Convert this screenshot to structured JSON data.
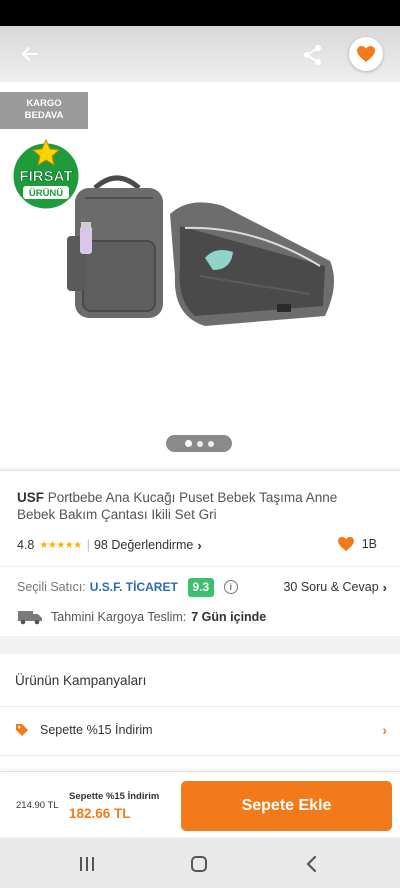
{
  "header": {
    "back_icon": "arrow-left-icon",
    "share_icon": "share-icon",
    "favorite_icon": "heart-icon"
  },
  "badges": {
    "cargo_line1": "KARGO",
    "cargo_line2": "BEDAVA",
    "firsat_line1": "FIRSAT",
    "firsat_line2": "ÜRÜNÜ"
  },
  "gallery": {
    "image_count": 3,
    "active_index": 0
  },
  "product": {
    "brand": "USF",
    "name": "Portbebe Ana Kucağı Puset Bebek Taşıma Anne Bebek Bakım Çantası Ikili Set Gri",
    "rating": "4.8",
    "stars": "★★★★★",
    "reviews": "98 Değerlendirme",
    "favorite_count": "1B"
  },
  "seller": {
    "label": "Seçili Satıcı:",
    "name": "U.S.F. TİCARET",
    "score": "9.3",
    "qa": "30 Soru & Cevap"
  },
  "delivery": {
    "label": "Tahmini Kargoya Teslim:",
    "value": "7 Gün içinde"
  },
  "campaigns": {
    "title": "Ürünün Kampanyaları",
    "items": [
      {
        "label": "Sepette %15 İndirim",
        "icon": "tag-icon"
      }
    ]
  },
  "checkout": {
    "old_price": "214.90 TL",
    "promo_label": "Sepette %15 İndirim",
    "new_price": "182.66 TL",
    "add_button": "Sepete Ekle"
  },
  "system_nav": {
    "recents_icon": "recents-icon",
    "home_icon": "home-icon",
    "back_icon": "back-chevron-icon"
  },
  "colors": {
    "accent": "#f27a1a",
    "seller_link": "#2b6cb0",
    "score_green": "#3cbf6f",
    "star": "#ffb300",
    "firsat_green": "#1e9b3a"
  }
}
